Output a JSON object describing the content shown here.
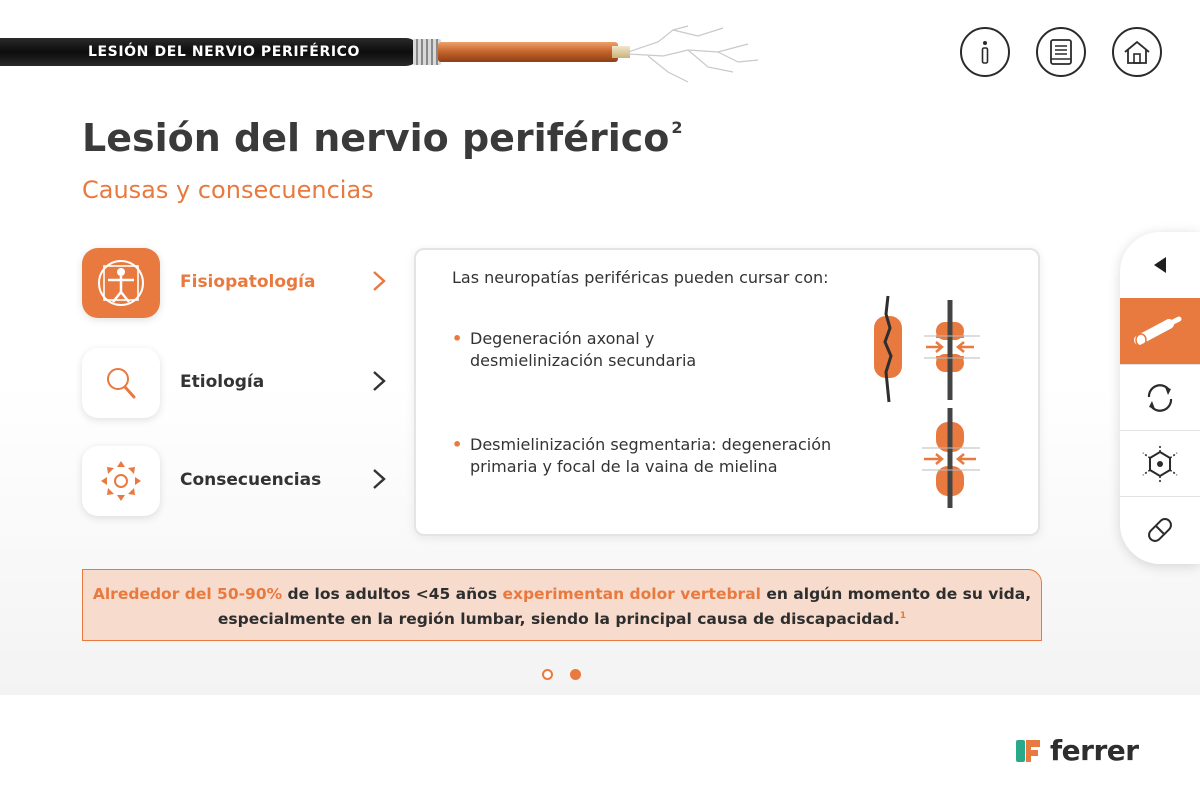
{
  "header": {
    "section_label": "LESIÓN DEL NERVIO PERIFÉRICO",
    "buttons": [
      {
        "name": "info",
        "icon": "info-icon"
      },
      {
        "name": "references",
        "icon": "book-icon"
      },
      {
        "name": "home",
        "icon": "home-icon"
      }
    ]
  },
  "page": {
    "title": "Lesión del nervio periférico",
    "title_sup": "2",
    "subtitle": "Causas y consecuencias"
  },
  "menu": [
    {
      "label": "Fisiopatología",
      "icon": "vitruvian-man-icon",
      "active": true
    },
    {
      "label": "Etiología",
      "icon": "magnifier-icon",
      "active": false
    },
    {
      "label": "Consecuencias",
      "icon": "radiating-arrows-icon",
      "active": false
    }
  ],
  "card": {
    "intro": "Las neuropatías periféricas pueden cursar con:",
    "bullets": [
      {
        "line1": "Degeneración axonal y",
        "line2": "desmielinización secundaria",
        "icon": "axonal-degeneration-icon"
      },
      {
        "line1": "Desmielinización segmentaria: degeneración",
        "line2": "primaria y focal de la vaina de mielina",
        "icon": "segmental-demyelination-icon"
      }
    ]
  },
  "side_rail": [
    {
      "icon": "collapse-triangle-icon",
      "active": false
    },
    {
      "icon": "nerve-cable-icon",
      "active": true
    },
    {
      "icon": "cycle-arrows-icon",
      "active": false
    },
    {
      "icon": "molecule-icon",
      "active": false
    },
    {
      "icon": "pill-icon",
      "active": false
    }
  ],
  "banner": {
    "hl1": "Alrededor del 50-90%",
    "t1": " de los adultos <45 años ",
    "hl2": "experimentan dolor vertebral",
    "t2": " en algún momento de su vida,",
    "line2": "especialmente en la región lumbar, siendo la principal causa de discapacidad.",
    "ref": "1"
  },
  "pagination": {
    "total": 2,
    "current": 2
  },
  "brand": {
    "name": "ferrer"
  },
  "colors": {
    "accent": "#e8793f",
    "banner_bg": "#f7dccd",
    "dark": "#2e2e2e"
  }
}
